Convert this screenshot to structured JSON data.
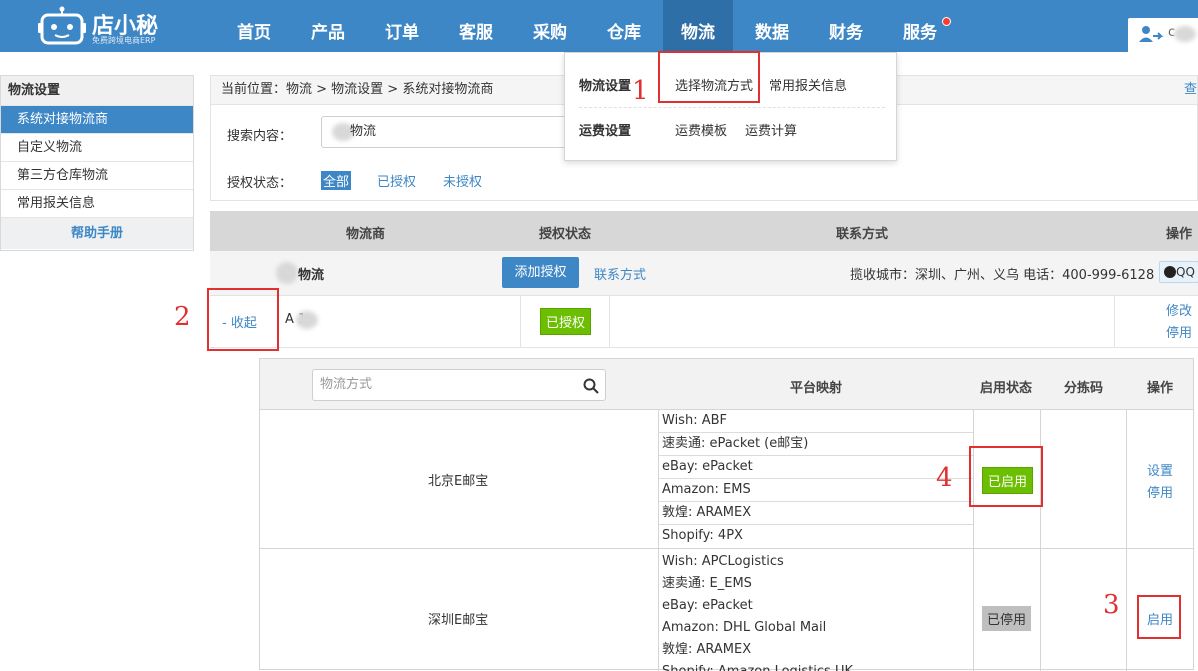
{
  "nav": {
    "logo_title": "店小秘",
    "logo_subtitle": "免费跨境电商ERP",
    "items": [
      {
        "label": "首页"
      },
      {
        "label": "产品"
      },
      {
        "label": "订单"
      },
      {
        "label": "客服"
      },
      {
        "label": "采购"
      },
      {
        "label": "仓库"
      },
      {
        "label": "物流"
      },
      {
        "label": "数据"
      },
      {
        "label": "财务"
      },
      {
        "label": "服务"
      }
    ],
    "active": "物流",
    "user_initial": "c"
  },
  "sidebar": {
    "title": "物流设置",
    "items": [
      {
        "label": "系统对接物流商"
      },
      {
        "label": "自定义物流"
      },
      {
        "label": "第三方仓库物流"
      },
      {
        "label": "常用报关信息"
      }
    ],
    "help": "帮助手册"
  },
  "breadcrumb": {
    "prefix": "当前位置：",
    "path": "物流 > 物流设置 > 系统对接物流商",
    "right_link": "查"
  },
  "filter": {
    "search_label": "搜索内容：",
    "search_value": "物流",
    "auth_label": "授权状态：",
    "auth_options": [
      {
        "label": "全部"
      },
      {
        "label": "已授权"
      },
      {
        "label": "未授权"
      }
    ]
  },
  "dropdown": {
    "group1_title": "物流设置",
    "group1_links": [
      {
        "label": "选择物流方式"
      },
      {
        "label": "常用报关信息"
      }
    ],
    "group2_title": "运费设置",
    "group2_links": [
      {
        "label": "运费模板"
      },
      {
        "label": "运费计算"
      }
    ]
  },
  "provider_table": {
    "headers": {
      "provider": "物流商",
      "auth_status": "授权状态",
      "contact": "联系方式",
      "actions": "操作"
    },
    "provider_name": "物流",
    "add_auth_label": "添加授权",
    "contact_link": "联系方式",
    "contact_info": "揽收城市：深圳、广州、义乌  电话：400-999-6128",
    "qq_label": "QQ",
    "account": {
      "toggle_label": "- 收起",
      "name": "A   1",
      "status": "已授权",
      "action_edit": "修改",
      "action_disable": "停用"
    }
  },
  "method_table": {
    "search_placeholder": "物流方式",
    "headers": {
      "mapping": "平台映射",
      "status": "启用状态",
      "sort_code": "分拣码",
      "actions": "操作"
    },
    "rows": [
      {
        "name": "北京E邮宝",
        "mappings": [
          "Wish:  ABF",
          "速卖通:  ePacket (e邮宝)",
          "eBay:  ePacket",
          "Amazon:  EMS",
          "敦煌:  ARAMEX",
          "Shopify:  4PX"
        ],
        "status": "已启用",
        "action1": "设置",
        "action2": "停用"
      },
      {
        "name": "深圳E邮宝",
        "mappings": [
          "Wish:  APCLogistics",
          "速卖通:  E_EMS",
          "eBay:  ePacket",
          "Amazon:  DHL Global Mail",
          "敦煌:  ARAMEX",
          "Shopify:  Amazon Logistics UK"
        ],
        "status": "已停用",
        "action1": "启用"
      }
    ]
  },
  "annotations": [
    "1",
    "2",
    "3",
    "4"
  ],
  "colors": {
    "nav_blue": "#3e87c6",
    "active_nav": "#2f6fa8",
    "green_badge": "#6cbf00",
    "annotation_red": "#e03030"
  }
}
